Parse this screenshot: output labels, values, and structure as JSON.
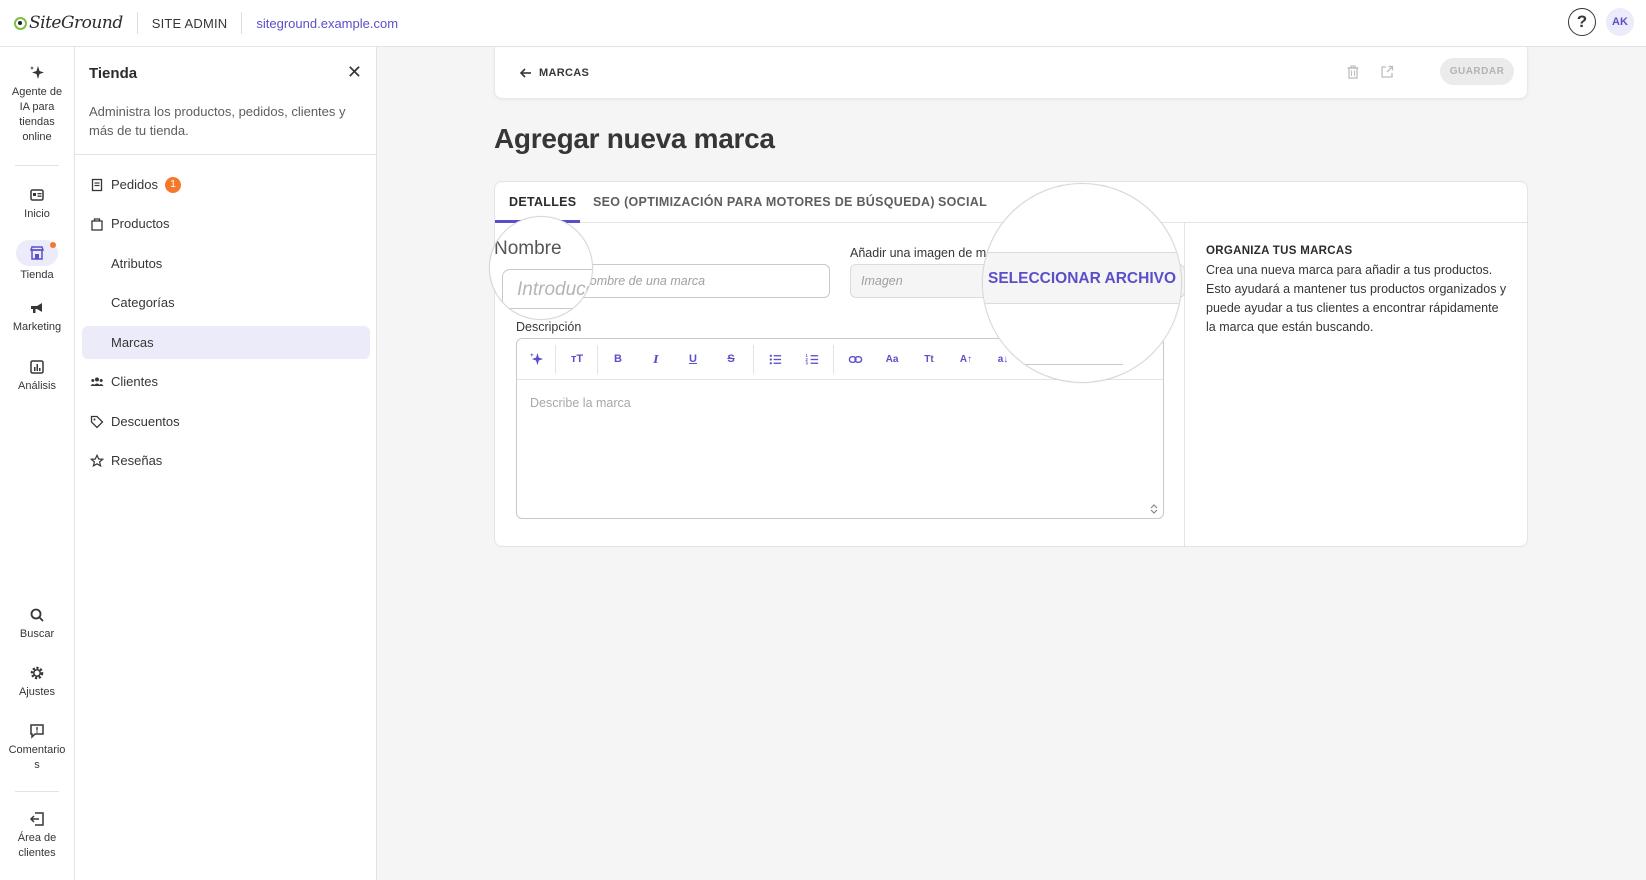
{
  "topbar": {
    "logo": "SiteGround",
    "section": "SITE ADMIN",
    "site_url": "siteground.example.com",
    "help": "?",
    "avatar_initials": "AK"
  },
  "rail": {
    "ai_agent": "Agente de IA para tiendas online",
    "home": "Inicio",
    "store": "Tienda",
    "marketing": "Marketing",
    "analytics": "Análisis",
    "search": "Buscar",
    "settings": "Ajustes",
    "feedback": "Comentarios",
    "client_area": "Área de clientes"
  },
  "panel": {
    "title": "Tienda",
    "description": "Administra los productos, pedidos, clientes y más de tu tienda.",
    "items": [
      {
        "label": "Pedidos",
        "badge": "1"
      },
      {
        "label": "Productos"
      },
      {
        "label": "Atributos"
      },
      {
        "label": "Categorías"
      },
      {
        "label": "Marcas"
      },
      {
        "label": "Clientes"
      },
      {
        "label": "Descuentos"
      },
      {
        "label": "Reseñas"
      }
    ]
  },
  "actionbar": {
    "back_label": "MARCAS",
    "save_label": "GUARDAR"
  },
  "page": {
    "title": "Agregar nueva marca"
  },
  "tabs": [
    {
      "label": "DETALLES",
      "active": true
    },
    {
      "label": "SEO (OPTIMIZACIÓN PARA MOTORES DE BÚSQUEDA)",
      "active": false
    },
    {
      "label": "SOCIAL",
      "active": false
    }
  ],
  "form": {
    "name_label": "Nombre",
    "name_placeholder": "Introduce el nombre de una marca",
    "image_label": "Añadir una imagen de marca",
    "image_placeholder": "Imagen",
    "file_button": "SELECCIONAR ARCHIVO",
    "description_label": "Descripción",
    "description_placeholder": "Describe la marca"
  },
  "aside": {
    "title": "ORGANIZA TUS MARCAS",
    "text": "Crea una nueva marca para añadir a tus productos. Esto ayudará a mantener tus productos organizados y puede ayudar a tus clientes a encontrar rápidamente la marca que están buscando."
  },
  "colors": {
    "accent": "#5a4fc9",
    "badge": "#f4792a",
    "active_bg": "#ecebfa"
  }
}
